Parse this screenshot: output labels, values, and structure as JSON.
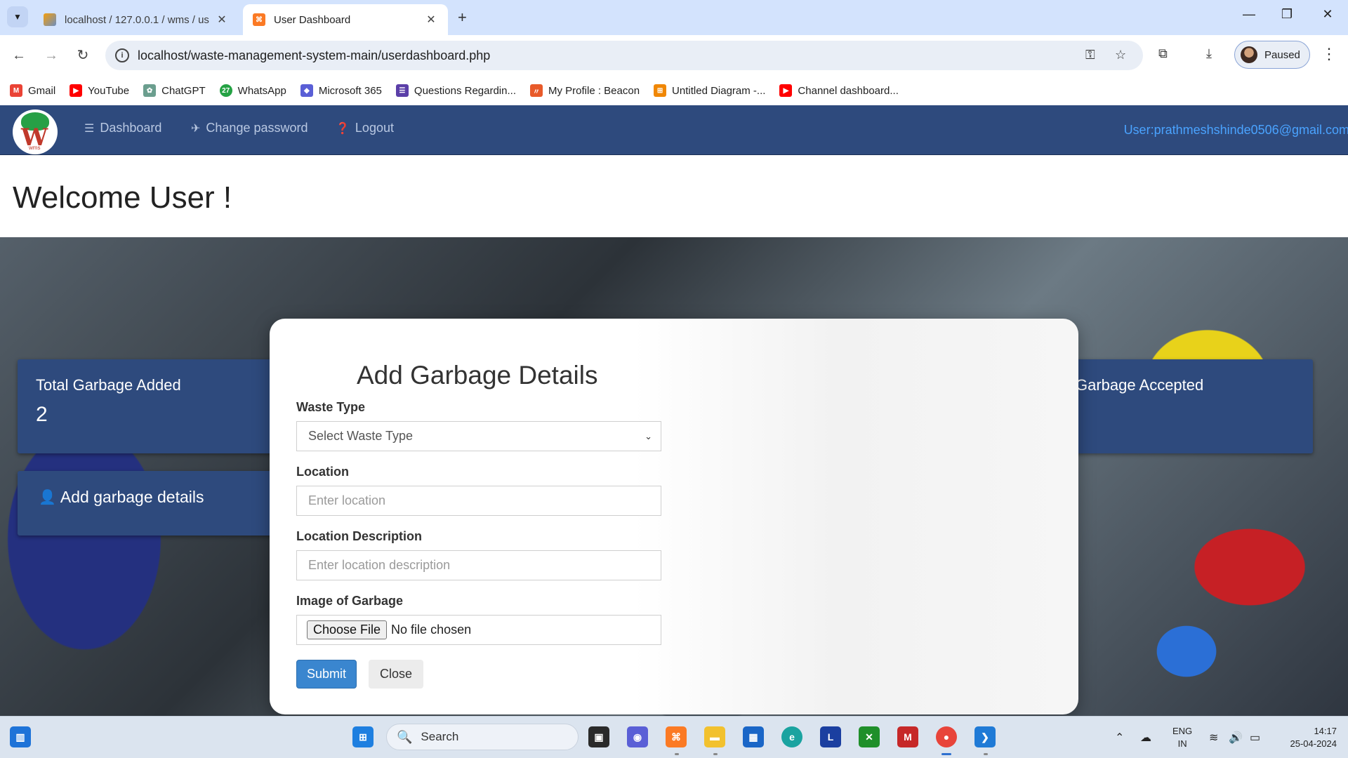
{
  "browser": {
    "tabs": [
      {
        "title": "localhost / 127.0.0.1 / wms / us",
        "active": false
      },
      {
        "title": "User Dashboard",
        "active": true
      }
    ],
    "url": "localhost/waste-management-system-main/userdashboard.php",
    "profile_label": "Paused",
    "bookmarks": [
      {
        "label": "Gmail",
        "icon": "gmail-icon",
        "color": "#ea4335"
      },
      {
        "label": "YouTube",
        "icon": "youtube-icon",
        "color": "#ff0000"
      },
      {
        "label": "ChatGPT",
        "icon": "chatgpt-icon",
        "color": "#6b9e8e"
      },
      {
        "label": "WhatsApp",
        "icon": "whatsapp-icon",
        "color": "#25a244"
      },
      {
        "label": "Microsoft 365",
        "icon": "microsoft365-icon",
        "color": "#5a5fd6"
      },
      {
        "label": "Questions Regardin...",
        "icon": "forms-icon",
        "color": "#5b3fa8"
      },
      {
        "label": "My Profile : Beacon",
        "icon": "beacon-icon",
        "color": "#e85a2a"
      },
      {
        "label": "Untitled Diagram -...",
        "icon": "drawio-icon",
        "color": "#f08705"
      },
      {
        "label": "Channel dashboard...",
        "icon": "youtube-studio-icon",
        "color": "#ff0000"
      }
    ]
  },
  "navbar": {
    "logo_text": "W",
    "logo_small": "wms",
    "links": [
      {
        "label": "Dashboard",
        "icon": "list-icon"
      },
      {
        "label": "Change password",
        "icon": "paper-plane-icon"
      },
      {
        "label": "Logout",
        "icon": "question-circle-icon"
      }
    ],
    "user": "User:prathmeshshinde0506@gmail.com"
  },
  "main": {
    "welcome": "Welcome User !",
    "cards": {
      "total_label": "Total Garbage Added",
      "total_value": "2",
      "add_label": "Add garbage details",
      "accepted_label": "Garbage Accepted"
    }
  },
  "modal": {
    "title": "Add Garbage Details",
    "waste_type_label": "Waste Type",
    "waste_type_selected": "Select Waste Type",
    "location_label": "Location",
    "location_placeholder": "Enter location",
    "description_label": "Location Description",
    "description_placeholder": "Enter location description",
    "image_label": "Image of Garbage",
    "choose_file": "Choose File",
    "no_file": "No file chosen",
    "submit": "Submit",
    "close": "Close"
  },
  "taskbar": {
    "search": "Search",
    "lang_top": "ENG",
    "lang_bottom": "IN",
    "time": "14:17",
    "date": "25-04-2024"
  },
  "colors": {
    "navbar": "#2e4a7d",
    "card": "#2e4a7d",
    "submit": "#3a86cf",
    "user_link": "#4aa3ff"
  }
}
